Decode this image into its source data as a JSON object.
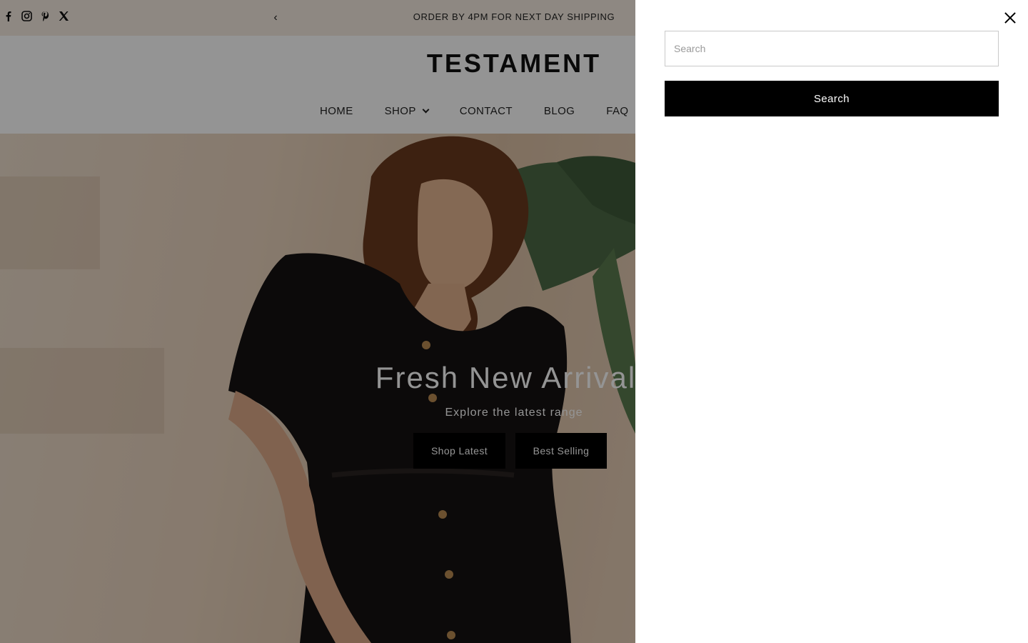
{
  "announcement": {
    "social_icons": [
      "facebook-icon",
      "instagram-icon",
      "pinterest-icon",
      "x-icon"
    ],
    "prev_arrow": "‹",
    "text": "ORDER BY 4PM FOR NEXT DAY SHIPPING"
  },
  "header": {
    "logo": "TESTAMENT",
    "nav": [
      {
        "label": "HOME"
      },
      {
        "label": "SHOP",
        "has_dropdown": true
      },
      {
        "label": "CONTACT"
      },
      {
        "label": "BLOG"
      },
      {
        "label": "FAQ"
      }
    ]
  },
  "hero": {
    "title": "Fresh New Arrivals",
    "subtitle": "Explore the latest range",
    "buttons": [
      {
        "label": "Shop Latest"
      },
      {
        "label": "Best Selling"
      }
    ]
  },
  "search_drawer": {
    "input_placeholder": "Search",
    "input_value": "",
    "submit_label": "Search",
    "close_icon": "close-icon"
  },
  "colors": {
    "announcement_bg": "#f4ebe0",
    "overlay": "rgba(0,0,0,0.42)",
    "button_bg": "#000000",
    "button_text": "#ffffff"
  }
}
